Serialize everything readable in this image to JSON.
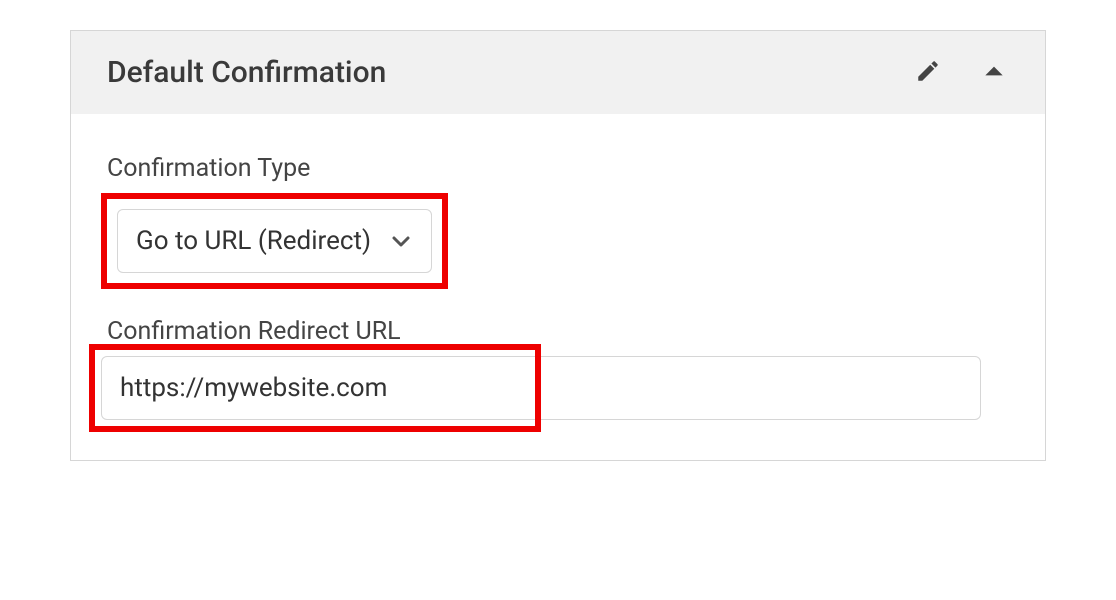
{
  "panel": {
    "title": "Default Confirmation"
  },
  "fields": {
    "type": {
      "label": "Confirmation Type",
      "selected": "Go to URL (Redirect)"
    },
    "redirect": {
      "label": "Confirmation Redirect URL",
      "value": "https://mywebsite.com"
    }
  }
}
